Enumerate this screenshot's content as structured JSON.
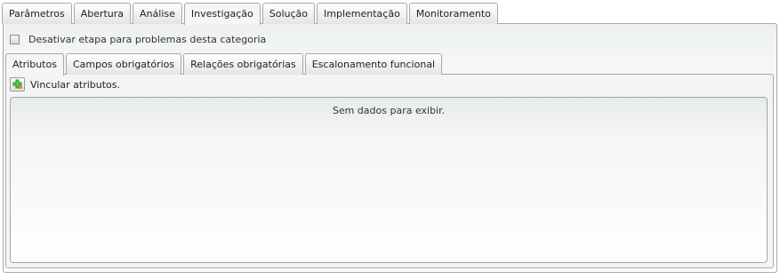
{
  "top_tabs": [
    {
      "label": "Parâmetros"
    },
    {
      "label": "Abertura"
    },
    {
      "label": "Análise"
    },
    {
      "label": "Investigação",
      "active": true
    },
    {
      "label": "Solução"
    },
    {
      "label": "Implementação"
    },
    {
      "label": "Monitoramento"
    }
  ],
  "settings": {
    "disable_step_label": "Desativar etapa para problemas desta categoria",
    "disable_step_checked": false
  },
  "inner_tabs": [
    {
      "label": "Atributos",
      "active": true
    },
    {
      "label": "Campos obrigatórios"
    },
    {
      "label": "Relações obrigatórias"
    },
    {
      "label": "Escalonamento funcional"
    }
  ],
  "toolbar": {
    "link_attributes_label": "Vincular atributos.",
    "link_attributes_icon": "add-link-icon"
  },
  "grid": {
    "empty_message": "Sem dados para exibir."
  },
  "colors": {
    "border": "#a9a9a9",
    "icon_green": "#2e8b2e",
    "icon_orange": "#e08a1e"
  }
}
